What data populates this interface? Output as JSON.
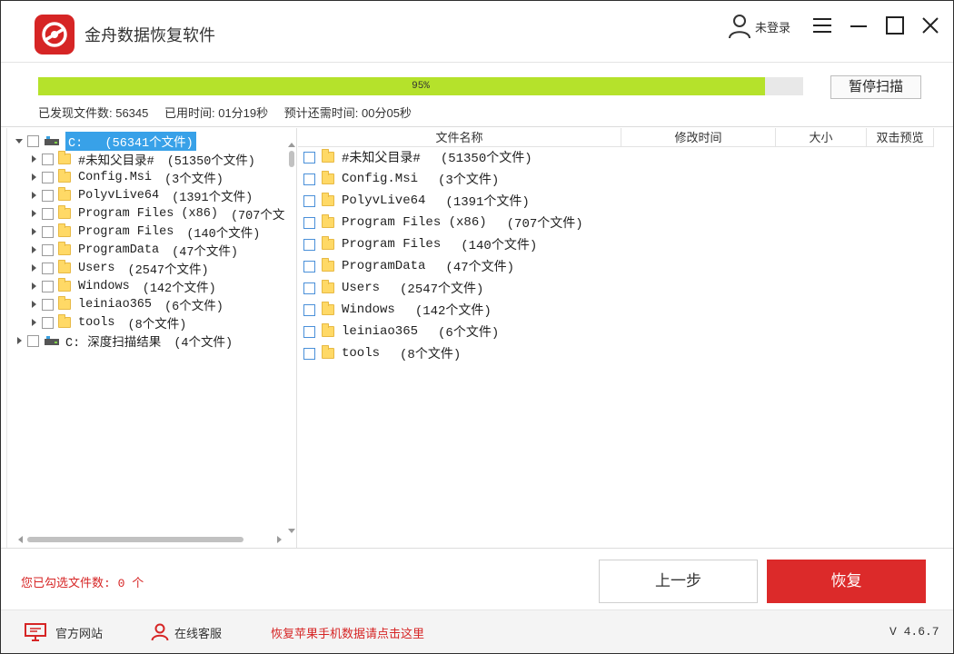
{
  "app": {
    "title": "金舟数据恢复软件",
    "user_label": "未登录",
    "accent_color": "#d62525"
  },
  "scan": {
    "progress_percent": 95,
    "progress_text": "95%",
    "pause_label": "暂停扫描",
    "found_files": "已发现文件数: 56345",
    "elapsed": "已用时间: 01分19秒",
    "remaining": "预计还需时间: 00分05秒"
  },
  "tree": {
    "root": {
      "label": "C:",
      "count": "(56341个文件)"
    },
    "items": [
      {
        "label": "#未知父目录#",
        "count": "(51350个文件)"
      },
      {
        "label": "Config.Msi",
        "count": "(3个文件)"
      },
      {
        "label": "PolyvLive64",
        "count": "(1391个文件)"
      },
      {
        "label": "Program Files (x86)",
        "count": "(707个文"
      },
      {
        "label": "Program Files",
        "count": "(140个文件)"
      },
      {
        "label": "ProgramData",
        "count": "(47个文件)"
      },
      {
        "label": "Users",
        "count": "(2547个文件)"
      },
      {
        "label": "Windows",
        "count": "(142个文件)"
      },
      {
        "label": "leiniao365",
        "count": "(6个文件)"
      },
      {
        "label": "tools",
        "count": "(8个文件)"
      }
    ],
    "deep_scan": {
      "label": "C: 深度扫描结果",
      "count": "(4个文件)"
    }
  },
  "list": {
    "columns": [
      "文件名称",
      "修改时间",
      "大小",
      "双击预览"
    ],
    "rows": [
      {
        "name": "#未知父目录#",
        "count": "(51350个文件)"
      },
      {
        "name": "Config.Msi",
        "count": "(3个文件)"
      },
      {
        "name": "PolyvLive64",
        "count": "(1391个文件)"
      },
      {
        "name": "Program Files (x86)",
        "count": "(707个文件)"
      },
      {
        "name": "Program Files",
        "count": "(140个文件)"
      },
      {
        "name": "ProgramData",
        "count": "(47个文件)"
      },
      {
        "name": "Users",
        "count": "(2547个文件)"
      },
      {
        "name": "Windows",
        "count": "(142个文件)"
      },
      {
        "name": "leiniao365",
        "count": "(6个文件)"
      },
      {
        "name": "tools",
        "count": "(8个文件)"
      }
    ]
  },
  "bottom": {
    "selected_count": "您已勾选文件数: 0 个",
    "prev_label": "上一步",
    "recover_label": "恢复"
  },
  "footer": {
    "website_label": "官方网站",
    "service_label": "在线客服",
    "apple_link": "恢复苹果手机数据请点击这里",
    "version": "V 4.6.7"
  }
}
